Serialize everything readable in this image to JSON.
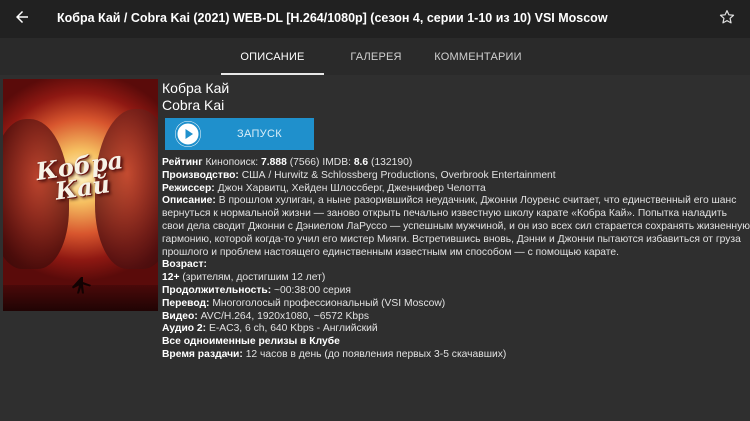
{
  "header": {
    "title": "Кобра Кай / Cobra Kai (2021) WEB-DL [H.264/1080p] (сезон 4, серии 1-10 из 10) VSI Moscow",
    "back_icon": "arrow-left-icon",
    "favorite_icon": "star-outline-icon"
  },
  "tabs": [
    {
      "label": "ОПИСАНИЕ",
      "active": true
    },
    {
      "label": "ГАЛЕРЕЯ",
      "active": false
    },
    {
      "label": "КОММЕНТАРИИ",
      "active": false
    }
  ],
  "poster": {
    "logo_line1": "Кобра",
    "logo_line2": "Кай"
  },
  "info": {
    "name_ru": "Кобра Кай",
    "name_en": "Cobra Kai",
    "launch_label": "ЗАПУСК",
    "rating_label": "Рейтинг",
    "rating_kp_prefix": "Кинопоиск:",
    "rating_kp_value": "7.888",
    "rating_kp_votes": "(7566)",
    "rating_imdb_prefix": "IMDB:",
    "rating_imdb_value": "8.6",
    "rating_imdb_votes": "(132190)",
    "production_label": "Производство:",
    "production_value": "США / Hurwitz & Schlossberg Productions, Overbrook Entertainment",
    "director_label": "Режиссер:",
    "director_value": "Джон Харвитц, Хейден Шлоссберг, Дженнифер Челотта",
    "description_label": "Описание:",
    "description_value": "В прошлом хулиган, а ныне разорившийся неудачник, Джонни Лоуренс считает, что единственный его шанс вернуться к нормальной жизни — заново открыть печально известную школу карате «Кобра Кай». Попытка наладить свои дела сводит Джонни с Дэниелом ЛаРуссо — успешным мужчиной, и он изо всех сил старается сохранять жизненную гармонию, которой когда-то учил его мистер Мияги. Встретившись вновь, Дэнни и Джонни пытаются избавиться от груза прошлого и проблем настоящего единственным известным им способом — с помощью карате.",
    "age_label": "Возраст:",
    "age_value_bold": "12+",
    "age_value_note": "(зрителям, достигшим 12 лет)",
    "duration_label": "Продолжительность:",
    "duration_value": "~00:38:00 серия",
    "translation_label": "Перевод:",
    "translation_value": "Многоголосый профессиональный (VSI Moscow)",
    "video_label": "Видео:",
    "video_value": "AVC/H.264, 1920x1080, ~6572 Kbps",
    "audio_label": "Аудио 2:",
    "audio_value": "E-AC3, 6 ch, 640 Kbps - Английский",
    "releases_link": "Все одноименные релизы в Клубе",
    "seeding_label": "Время раздачи:",
    "seeding_value": "12 часов в день (до появления первых 3-5 скачавших)"
  }
}
